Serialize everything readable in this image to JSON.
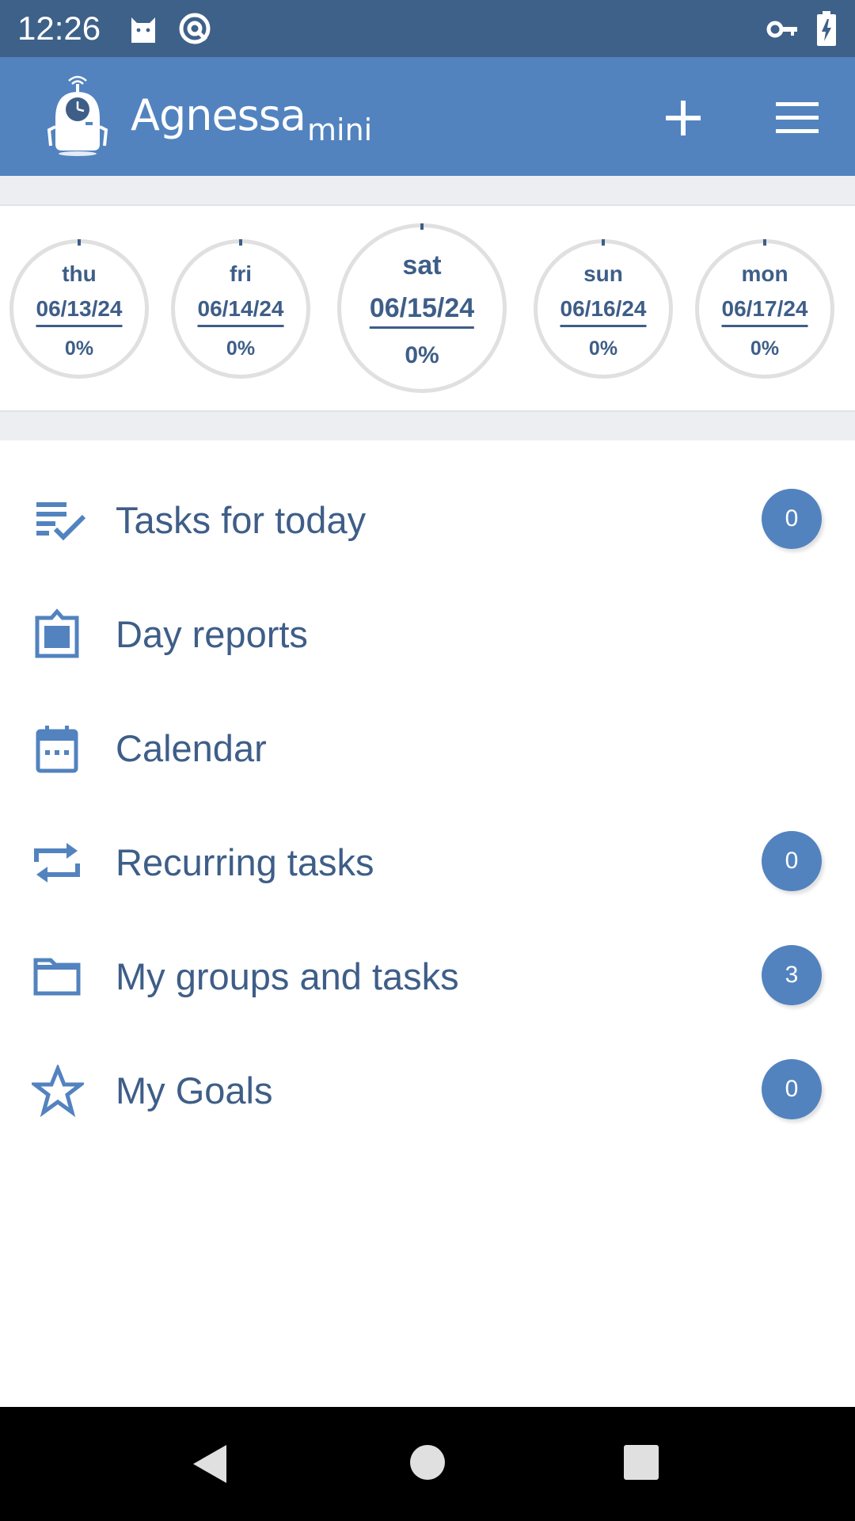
{
  "status_bar": {
    "time": "12:26",
    "icons_left": [
      "cat-notification-icon",
      "at-sign-icon"
    ],
    "icons_right": [
      "key-icon",
      "battery-charging-icon"
    ]
  },
  "app_bar": {
    "title": "Agnessa",
    "title_suffix": "mini",
    "logo_icon": "robot-logo-icon",
    "add_icon": "plus-icon",
    "menu_icon": "hamburger-menu-icon"
  },
  "days": [
    {
      "name": "thu",
      "date": "06/13/24",
      "percent": "0%",
      "progress": 0
    },
    {
      "name": "fri",
      "date": "06/14/24",
      "percent": "0%",
      "progress": 0
    },
    {
      "name": "sat",
      "date": "06/15/24",
      "percent": "0%",
      "progress": 0,
      "selected": true
    },
    {
      "name": "sun",
      "date": "06/16/24",
      "percent": "0%",
      "progress": 0
    },
    {
      "name": "mon",
      "date": "06/17/24",
      "percent": "0%",
      "progress": 0
    }
  ],
  "menu": [
    {
      "label": "Tasks for today",
      "icon": "task-list-check-icon",
      "badge": "0"
    },
    {
      "label": "Day reports",
      "icon": "clipboard-report-icon"
    },
    {
      "label": "Calendar",
      "icon": "calendar-icon"
    },
    {
      "label": "Recurring tasks",
      "icon": "repeat-icon",
      "badge": "0"
    },
    {
      "label": "My groups and tasks",
      "icon": "folder-icon",
      "badge": "3"
    },
    {
      "label": "My Goals",
      "icon": "star-outline-icon",
      "badge": "0"
    }
  ],
  "nav_bar": {
    "back_icon": "back-triangle-icon",
    "home_icon": "home-circle-icon",
    "recents_icon": "recents-square-icon"
  },
  "colors": {
    "status_bar": "#3e6189",
    "app_bar": "#5283bf",
    "accent_text": "#3e5e88",
    "badge": "#5283bf",
    "ring": "#e0e0e0"
  }
}
